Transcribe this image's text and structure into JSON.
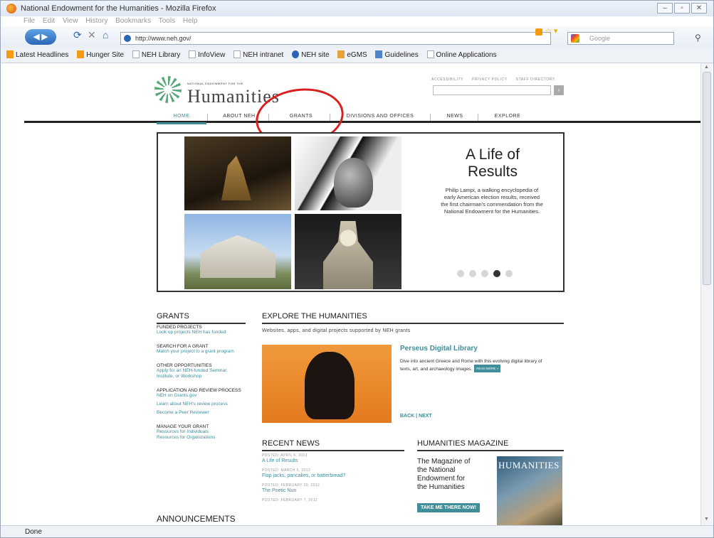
{
  "window": {
    "title": "National Endowment for the Humanities - Mozilla Firefox"
  },
  "menu": [
    "File",
    "Edit",
    "View",
    "History",
    "Bookmarks",
    "Tools",
    "Help"
  ],
  "navbar": {
    "url": "http://www.neh.gov/",
    "search_placeholder": "Google"
  },
  "bookmarks": [
    "Latest Headlines",
    "Hunger Site",
    "NEH Library",
    "InfoView",
    "NEH intranet",
    "NEH site",
    "eGMS",
    "Guidelines",
    "Online Applications"
  ],
  "status": "Done",
  "site": {
    "logo_small": "NATIONAL ENDOWMENT FOR THE",
    "logo_big": "Humanities",
    "utility": [
      "ACCESSIBILITY",
      "PRIVACY POLICY",
      "STAFF DIRECTORY"
    ],
    "nav": [
      "HOME",
      "ABOUT NEH",
      "GRANTS",
      "DIVISIONS AND OFFICES",
      "NEWS",
      "EXPLORE"
    ]
  },
  "hero": {
    "title": "A Life of Results",
    "text": "Philip Lampi, a walking encyclopedia of early American election results, received the first chairman's commendation from the National Endowment for the Humanities.",
    "dots": 5,
    "active_dot": 4
  },
  "grants": {
    "heading": "GRANTS",
    "sections": [
      {
        "title": "FUNDED PROJECTS",
        "links": [
          "Look up projects NEH has funded"
        ]
      },
      {
        "title": "SEARCH FOR A GRANT",
        "links": [
          "Match your project to a grant program"
        ]
      },
      {
        "title": "OTHER OPPORTUNITIES",
        "links": [
          "Apply for an NEH-funded Seminar, Institute, or Workshop"
        ]
      },
      {
        "title": "APPLICATION AND REVIEW PROCESS",
        "links": [
          "NEH on Grants.gov",
          "Learn about NEH's review process",
          "Become a Peer Reviewer"
        ]
      },
      {
        "title": "MANAGE YOUR GRANT",
        "links": [
          "Resources for Individuals",
          "Resources for Organizations"
        ]
      }
    ],
    "announcements": "ANNOUNCEMENTS"
  },
  "explore": {
    "heading": "EXPLORE THE HUMANITIES",
    "subtitle": "Websites, apps, and digital projects supported by NEH grants",
    "feature_title": "Perseus Digital Library",
    "feature_text": "Dive into ancient Greece and Rome with this evolving digital library of texts, art, and archaeology images.",
    "read_more": "READ MORE »",
    "back_next": "BACK | NEXT"
  },
  "news": {
    "heading": "RECENT NEWS",
    "items": [
      {
        "date": "POSTED: APRIL 6, 2012",
        "title": "A Life of Results"
      },
      {
        "date": "POSTED: MARCH 6, 2012",
        "title": "Flap jacks, pancakes, or batterbread?"
      },
      {
        "date": "POSTED: FEBRUARY 20, 2012",
        "title": "The Poetic Nun"
      },
      {
        "date": "POSTED: FEBRUARY 7, 2012",
        "title": ""
      }
    ]
  },
  "magazine": {
    "heading": "HUMANITIES MAGAZINE",
    "text": "The Magazine of the National Endowment for the Humanities",
    "button": "TAKE ME THERE NOW!",
    "cover_title": "HUMANITIES"
  }
}
